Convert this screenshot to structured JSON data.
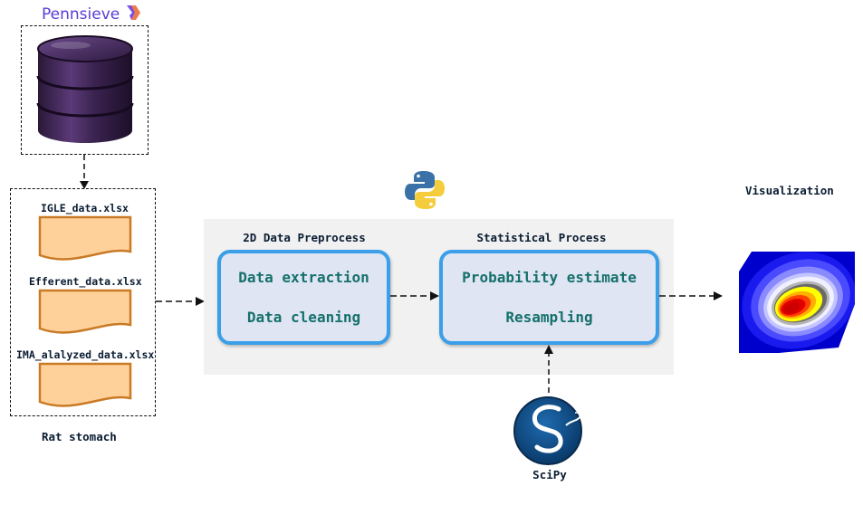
{
  "source": {
    "brand": "Pennsieve"
  },
  "files": [
    {
      "name": "IGLE_data.xlsx"
    },
    {
      "name": "Efferent_data.xlsx"
    },
    {
      "name": "IMA_alalyzed_data.xlsx"
    }
  ],
  "files_caption": "Rat stomach",
  "preprocess": {
    "title": "2D Data Preprocess",
    "steps": [
      "Data extraction",
      "Data cleaning"
    ]
  },
  "statistical": {
    "title": "Statistical Process",
    "steps": [
      "Probability estimate",
      "Resampling"
    ]
  },
  "scipy": {
    "label": "SciPy"
  },
  "visualization": {
    "title": "Visualization"
  },
  "colors": {
    "box_border": "#3a9ee8",
    "box_fill": "#dfe5f2",
    "step_text": "#16706c",
    "file_fill": "#ffd19a",
    "file_border": "#c97a25",
    "database": "#3b2350",
    "brand": "#5a3bd6"
  },
  "icons": [
    "database-icon",
    "python-logo-icon",
    "scipy-logo-icon",
    "heatmap-thumbnail",
    "pennsieve-logo-icon"
  ]
}
